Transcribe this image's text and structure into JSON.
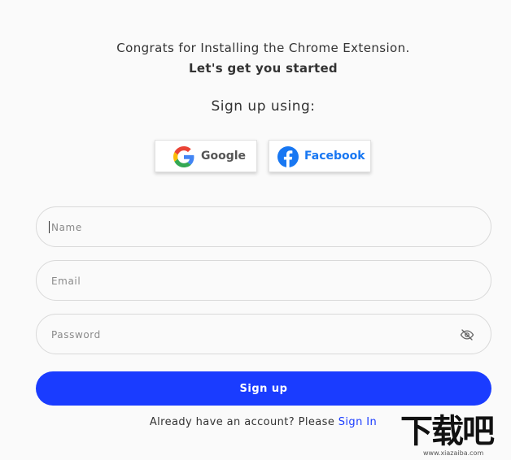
{
  "header": {
    "line1": "Congrats for Installing the Chrome Extension.",
    "line2": "Let's get you started"
  },
  "signup_prompt": "Sign up using:",
  "social": {
    "google_label": "Google",
    "facebook_label": "Facebook"
  },
  "form": {
    "name_placeholder": "Name",
    "email_placeholder": "Email",
    "password_placeholder": "Password",
    "submit_label": "Sign up"
  },
  "footer": {
    "prompt": "Already have an account? Please ",
    "link": "Sign In"
  },
  "watermark": {
    "text": "下载吧",
    "url_text": "www.xiazaiba.com"
  },
  "colors": {
    "primary": "#1a3cff",
    "facebook": "#1877f2",
    "background": "#fafafa"
  },
  "icons": {
    "google": "google-g-logo",
    "facebook": "facebook-f-logo",
    "password_toggle": "eye-slash-icon"
  }
}
